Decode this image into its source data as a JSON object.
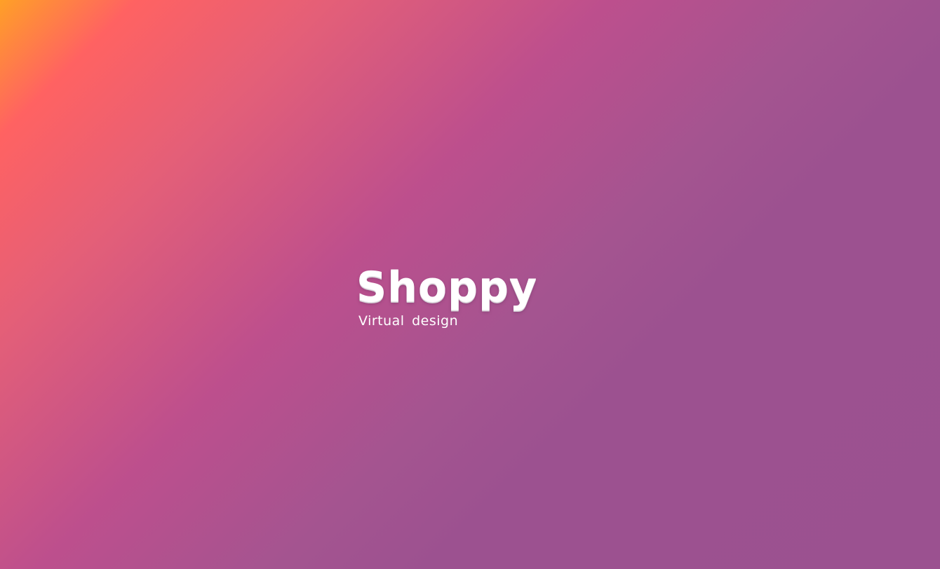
{
  "splash": {
    "brand_name": "Shoppy",
    "tagline": "Virtual design"
  },
  "colors": {
    "gradient_start": "#ffa027",
    "gradient_mid_1": "#ff6262",
    "gradient_mid_2": "#bd4f8d",
    "gradient_end": "#9b5190",
    "text": "#ffffff"
  }
}
